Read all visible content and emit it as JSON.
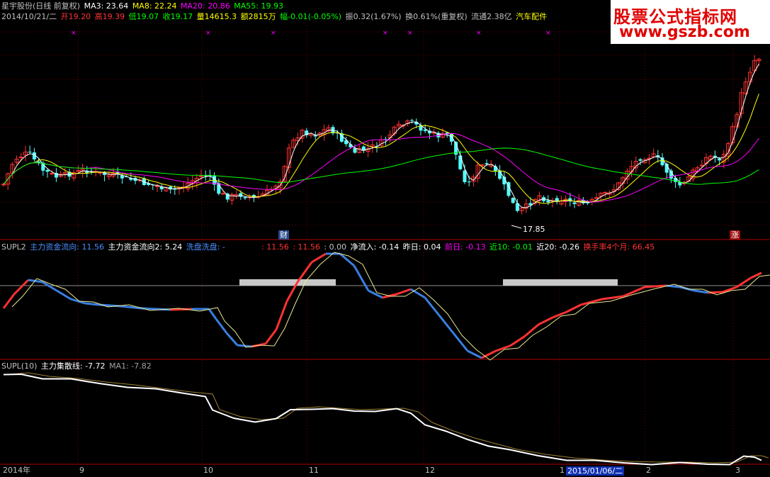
{
  "header": {
    "stock_title": "星宇股份(日线 前复权)",
    "ma3": "MA3: 23.64",
    "ma8": "MA8: 22.24",
    "ma20": "MA20: 20.86",
    "ma55": "MA55: 19.93",
    "date": "2014/10/21/二",
    "open": "开19.20",
    "high": "高19.39",
    "low": "低19.07",
    "close": "收19.17",
    "volume": "量14615.3",
    "amount": "额2815万",
    "change": "幅-0.01(-0.05%)",
    "amplitude": "振0.32(1.67%)",
    "turnover": "换0.61%(重复权)",
    "float_cap": "流通2.38亿",
    "industry": "汽车配件"
  },
  "watermark": {
    "line1": "股票公式指标网",
    "line2": "www.gszb.com"
  },
  "price_panel": {
    "low_label": "17.85",
    "fin_tag": "财",
    "up_tag": "涨"
  },
  "supl2": {
    "name": "SUPL2",
    "main_flow": "主力资金流向: 11.56",
    "main_flow2": "主力资金流向2: 5.24",
    "wash": "洗盘洗盘: -",
    "v1": ": 11.56",
    "v2": ": 11.56",
    "v3": ": 0.00",
    "net_in": "净流入: -0.14",
    "yesterday": "昨日: 0.04",
    "prev_day": "前日: -0.13",
    "near10": "近10: -0.01",
    "near20": "近20: -0.26",
    "turnover4m": "换手率4个月: 66.45"
  },
  "supl": {
    "name": "SUPL(10)",
    "gather": "主力集散线: -7.72",
    "ma1": "MA1: -7.82"
  },
  "xaxis": {
    "year": "2014年",
    "m9": "9",
    "m10": "10",
    "m11": "11",
    "m12": "12",
    "m1": "1",
    "cursor_date": "2015/01/06/二",
    "m2": "2",
    "m3": "3"
  },
  "colors": {
    "bg": "#000000",
    "up": "#ff3232",
    "down": "#54ffff",
    "ma3": "#ffffff",
    "ma8": "#ffff00",
    "ma20": "#ff00ff",
    "ma55": "#00ff00",
    "divider": "#b00000"
  }
}
